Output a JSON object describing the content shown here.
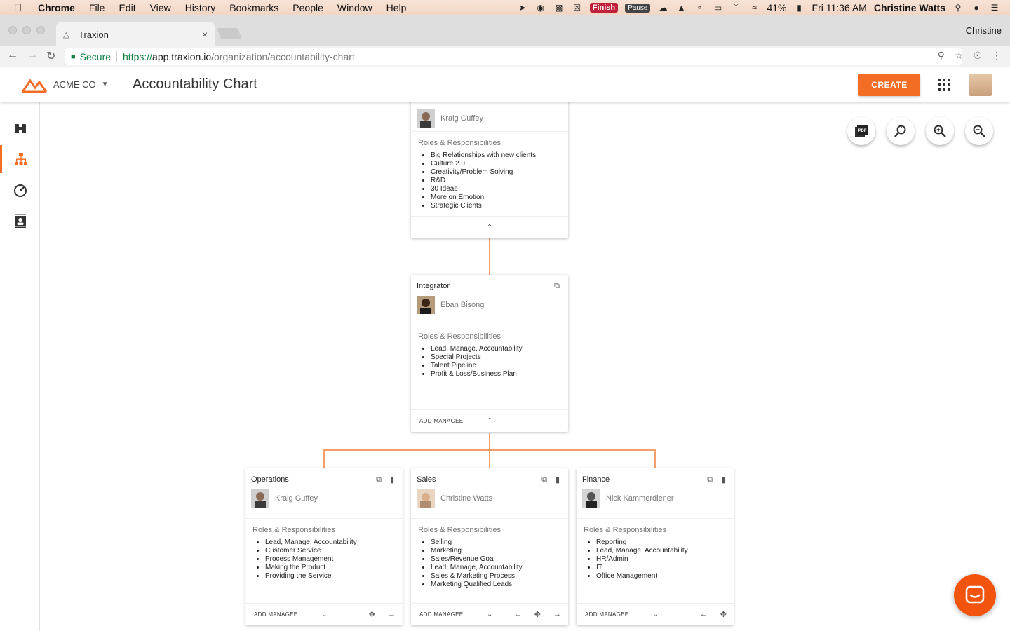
{
  "menubar": {
    "app": "Chrome",
    "items": [
      "File",
      "Edit",
      "View",
      "History",
      "Bookmarks",
      "People",
      "Window",
      "Help"
    ],
    "finish_badge": "Finish",
    "pause_badge": "Pause",
    "battery": "41%",
    "clock": "Fri 11:36 AM",
    "user": "Christine Watts"
  },
  "browser": {
    "tab_title": "Traxion",
    "profile": "Christine",
    "secure_label": "Secure",
    "url_proto": "https://",
    "url_host": "app.traxion.io",
    "url_path": "/organization/accountability-chart"
  },
  "header": {
    "company": "ACME CO",
    "title": "Accountability Chart",
    "create_label": "CREATE",
    "accent": "#f46d25"
  },
  "chart": {
    "rr_label": "Roles & Responsibilities",
    "add_managee": "ADD MANAGEE",
    "top": {
      "person": "Kraig Guffey",
      "roles": [
        "Big Relationships with new clients",
        "Culture 2.0",
        "Creativity/Problem Solving",
        "R&D",
        "30 Ideas",
        "More on Emotion",
        "Strategic Clients"
      ]
    },
    "integrator": {
      "title": "Integrator",
      "person": "Eban Bisong",
      "roles": [
        "Lead, Manage, Accountability",
        "Special Projects",
        "Talent Pipeline",
        "Profit & Loss/Business Plan"
      ]
    },
    "operations": {
      "title": "Operations",
      "person": "Kraig Guffey",
      "roles": [
        "Lead, Manage, Accountability",
        "Customer Service",
        "Process Management",
        "Making the Product",
        "Providing the Service"
      ]
    },
    "sales": {
      "title": "Sales",
      "person": "Christine Watts",
      "roles": [
        "Selling",
        "Marketing",
        "Sales/Revenue Goal",
        "Lead, Manage, Accountability",
        "Sales & Marketing Process",
        "Marketing Qualified Leads"
      ]
    },
    "finance": {
      "title": "Finance",
      "person": "Nick Kammerdiener",
      "roles": [
        "Reporting",
        "Lead, Manage, Accountability",
        "HR/Admin",
        "IT",
        "Office Management"
      ]
    }
  },
  "toolbar": {
    "pdf_label": "PDF"
  }
}
